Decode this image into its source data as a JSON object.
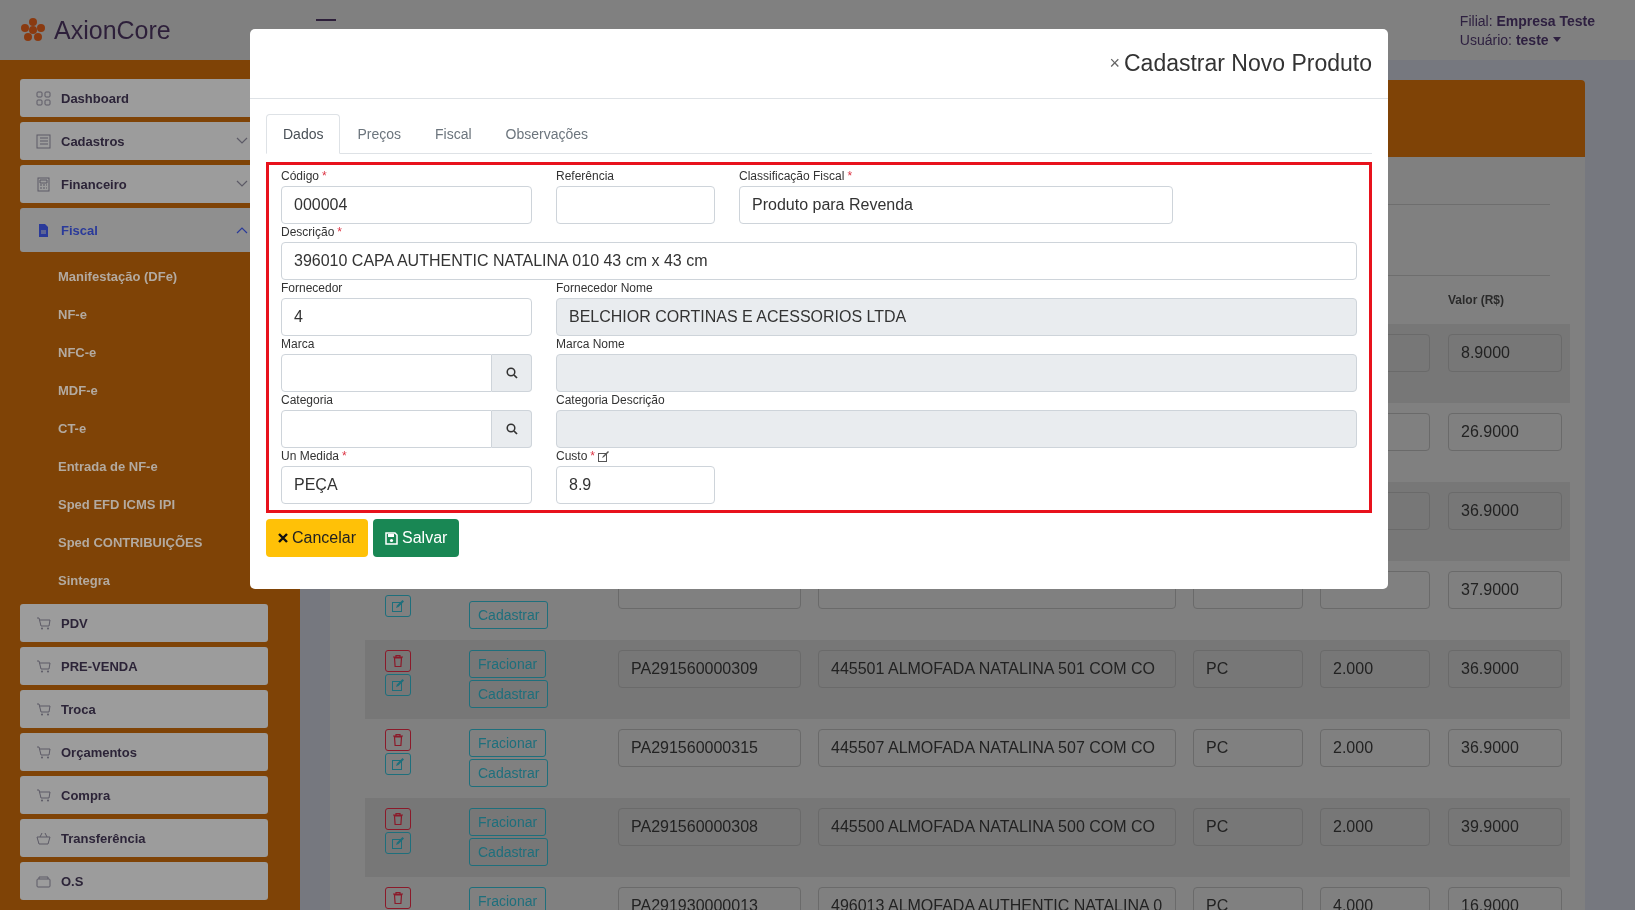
{
  "header": {
    "logo": "AxionCore",
    "branch_label": "Filial:",
    "branch": "Empresa Teste",
    "user_label": "Usuário:",
    "user": "teste"
  },
  "sidebar": {
    "items": [
      {
        "label": "Dashboard",
        "selected": false
      },
      {
        "label": "Cadastros",
        "selected": false,
        "expanded": false
      },
      {
        "label": "Financeiro",
        "selected": false,
        "expanded": false
      },
      {
        "label": "Fiscal",
        "selected": true,
        "expanded": true,
        "children": [
          {
            "label": "Manifestação (DFe)"
          },
          {
            "label": "NF-e"
          },
          {
            "label": "NFC-e"
          },
          {
            "label": "MDF-e"
          },
          {
            "label": "CT-e"
          },
          {
            "label": "Entrada de NF-e"
          },
          {
            "label": "Sped EFD ICMS IPI"
          },
          {
            "label": "Sped CONTRIBUIÇÕES"
          },
          {
            "label": "Sintegra"
          }
        ]
      },
      {
        "label": "PDV",
        "selected": false
      },
      {
        "label": "PRE-VENDA",
        "selected": false
      },
      {
        "label": "Troca",
        "selected": false
      },
      {
        "label": "Orçamentos",
        "selected": false
      },
      {
        "label": "Compra",
        "selected": false
      },
      {
        "label": "Transferência",
        "selected": false
      },
      {
        "label": "O.S",
        "selected": false
      }
    ]
  },
  "table": {
    "visible_heading": "Valor (R$)",
    "rows": [
      {
        "valor": "8.9000"
      },
      {
        "valor": "26.9000"
      },
      {
        "valor": "36.9000"
      },
      {
        "icon_buttons": [
          {
            "kind": "edit"
          }
        ],
        "text_buttons": [
          {
            "label": "Cadastrar",
            "kind": "register"
          }
        ],
        "valor": "37.9000"
      },
      {
        "icon_buttons": [
          {
            "kind": "delete"
          },
          {
            "kind": "edit"
          }
        ],
        "text_buttons": [
          {
            "label": "Fracionar",
            "kind": "split"
          },
          {
            "label": "Cadastrar",
            "kind": "register"
          }
        ],
        "code": "PA291560000309",
        "description": "445501  ALMOFADA NATALINA 501 COM CO",
        "unit": "PC",
        "qty": "2.000",
        "valor": "36.9000"
      },
      {
        "icon_buttons": [
          {
            "kind": "delete"
          },
          {
            "kind": "edit"
          }
        ],
        "text_buttons": [
          {
            "label": "Fracionar",
            "kind": "split"
          },
          {
            "label": "Cadastrar",
            "kind": "register"
          }
        ],
        "code": "PA291560000315",
        "description": "445507  ALMOFADA NATALINA 507 COM CO",
        "unit": "PC",
        "qty": "2.000",
        "valor": "36.9000"
      },
      {
        "icon_buttons": [
          {
            "kind": "delete"
          },
          {
            "kind": "edit"
          }
        ],
        "text_buttons": [
          {
            "label": "Fracionar",
            "kind": "split"
          },
          {
            "label": "Cadastrar",
            "kind": "register"
          }
        ],
        "code": "PA291560000308",
        "description": "445500  ALMOFADA NATALINA 500 COM CO",
        "unit": "PC",
        "qty": "2.000",
        "valor": "39.9000"
      },
      {
        "icon_buttons": [
          {
            "kind": "delete"
          }
        ],
        "text_buttons": [
          {
            "label": "Fracionar",
            "kind": "split"
          }
        ],
        "code": "PA291930000013",
        "description": "496013  ALMOFADA AUTHENTIC NATALINA 0",
        "unit": "PC",
        "qty": "4.000",
        "valor": "16.9000"
      }
    ]
  },
  "modal": {
    "close": "×",
    "title": "Cadastrar Novo Produto",
    "tabs": [
      {
        "label": "Dados",
        "selected": true
      },
      {
        "label": "Preços",
        "selected": false
      },
      {
        "label": "Fiscal",
        "selected": false
      },
      {
        "label": "Observações",
        "selected": false
      }
    ],
    "form_rows": [
      [
        {
          "label": "Código",
          "required_mark": "*",
          "kind": "text",
          "value": "000004"
        },
        {
          "label": "Referência",
          "kind": "text"
        },
        {
          "label": "Classificação Fiscal",
          "required_mark": "*",
          "kind": "text",
          "value": "Produto para Revenda"
        }
      ],
      [
        {
          "label": "Descrição",
          "required_mark": "*",
          "kind": "text",
          "value": "396010  CAPA AUTHENTIC NATALINA 010 43 cm x 43 cm"
        }
      ],
      [
        {
          "label": "Fornecedor",
          "kind": "text",
          "value": "4"
        },
        {
          "label": "Fornecedor Nome",
          "kind": "readonly",
          "value": "BELCHIOR CORTINAS E ACESSORIOS LTDA"
        }
      ],
      [
        {
          "label": "Marca",
          "kind": "lookup"
        },
        {
          "label": "Marca Nome",
          "kind": "readonly"
        }
      ],
      [
        {
          "label": "Categoria",
          "kind": "lookup"
        },
        {
          "label": "Categoria Descrição",
          "kind": "readonly"
        }
      ],
      [
        {
          "label": "Un Medida",
          "required_mark": "*",
          "kind": "text",
          "value": "PEÇA"
        },
        {
          "label": "Custo",
          "required_mark": "*",
          "kind": "text",
          "value": "8.9",
          "note_icon": true
        }
      ]
    ],
    "buttons": [
      {
        "label": "Cancelar",
        "kind": "cancel"
      },
      {
        "label": "Salvar",
        "kind": "save"
      }
    ]
  }
}
